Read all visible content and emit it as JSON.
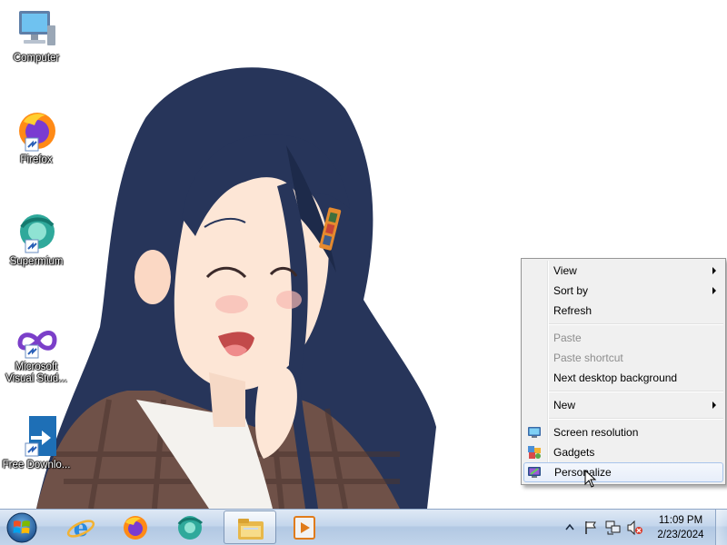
{
  "desktop": {
    "icons": [
      {
        "label": "Computer",
        "icon": "computer-icon"
      },
      {
        "label": "Firefox",
        "icon": "firefox-icon"
      },
      {
        "label": "Supermium",
        "icon": "supermium-icon"
      },
      {
        "label": "Microsoft Visual Stud...",
        "icon": "visual-studio-icon"
      },
      {
        "label": "Free Downlo...",
        "icon": "free-download-manager-icon"
      }
    ]
  },
  "context_menu": {
    "items": {
      "view": "View",
      "sort_by": "Sort by",
      "refresh": "Refresh",
      "paste": "Paste",
      "paste_shortcut": "Paste shortcut",
      "next_background": "Next desktop background",
      "new": "New",
      "screen_resolution": "Screen resolution",
      "gadgets": "Gadgets",
      "personalize": "Personalize"
    }
  },
  "taskbar": {
    "pinned": [
      "start-orb-icon",
      "internet-explorer-icon",
      "firefox-icon",
      "supermium-icon",
      "file-explorer-icon",
      "media-player-icon"
    ],
    "clock": {
      "time": "11:09 PM",
      "date": "2/23/2024"
    }
  },
  "colors": {
    "hair": "#27355a",
    "skin": "#fde6d6",
    "shirt": "#6f5148",
    "menu_bg": "#f0f0f0",
    "menu_hover_border": "#a8c4eb",
    "taskbar": "#c4d6ec"
  }
}
